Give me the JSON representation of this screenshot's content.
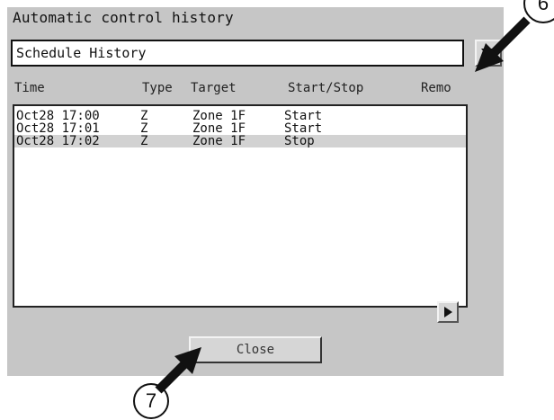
{
  "window": {
    "title": "Automatic control history"
  },
  "dropdown": {
    "selected_value": "Schedule History"
  },
  "table": {
    "headers": [
      "Time",
      "Type",
      "Target",
      "Start/Stop",
      "Remo"
    ],
    "rows": [
      {
        "time": "Oct28 17:00",
        "type": "Z",
        "target": "Zone 1F",
        "start_stop": "Start",
        "selected": false
      },
      {
        "time": "Oct28 17:01",
        "type": "Z",
        "target": "Zone 1F",
        "start_stop": "Start",
        "selected": false
      },
      {
        "time": "Oct28 17:02",
        "type": "Z",
        "target": "Zone 1F",
        "start_stop": "Stop",
        "selected": true
      }
    ]
  },
  "buttons": {
    "close_label": "Close"
  },
  "callouts": {
    "dropdown_callout": "6",
    "close_callout": "7"
  },
  "icons": {
    "dropdown_arrow": "triangle-down-icon",
    "scroll_right": "triangle-right-icon"
  },
  "colors": {
    "panel_bg": "#c6c6c6",
    "list_bg": "#ffffff",
    "selected_row_bg": "#d2d2d2"
  }
}
